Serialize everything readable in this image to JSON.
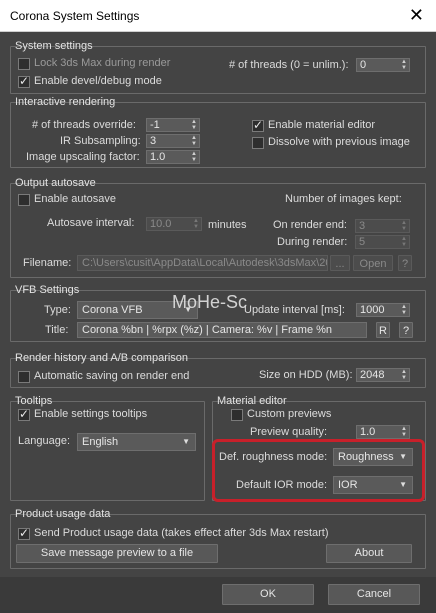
{
  "window": {
    "title": "Corona System Settings",
    "close": "✕"
  },
  "system": {
    "legend": "System settings",
    "lock_label": "Lock 3ds Max during render",
    "lock_checked": false,
    "devel_label": "Enable devel/debug mode",
    "devel_checked": true,
    "threads_label": "# of threads (0 = unlim.):",
    "threads_value": "0"
  },
  "interactive": {
    "legend": "Interactive rendering",
    "threads_override_label": "# of threads override:",
    "threads_override_value": "-1",
    "ir_sub_label": "IR Subsampling:",
    "ir_sub_value": "3",
    "upscale_label": "Image upscaling factor:",
    "upscale_value": "1.0",
    "material_editor_label": "Enable material editor",
    "material_editor_checked": true,
    "dissolve_label": "Dissolve with previous image",
    "dissolve_checked": false
  },
  "autosave": {
    "legend": "Output autosave",
    "enable_label": "Enable autosave",
    "enable_checked": false,
    "keep_label": "Number of images kept:",
    "interval_label": "Autosave interval:",
    "interval_value": "10.0",
    "minutes_label": "minutes",
    "on_end_label": "On render end:",
    "on_end_value": "3",
    "during_label": "During render:",
    "during_value": "5",
    "filename_label": "Filename:",
    "filename_value": "C:\\Users\\cusit\\AppData\\Local\\Autodesk\\3dsMax\\20",
    "ellipsis_button": "...",
    "open_button": "Open",
    "help_button": "?"
  },
  "vfb": {
    "legend": "VFB Settings",
    "type_label": "Type:",
    "type_value": "Corona VFB",
    "update_label": "Update interval [ms]:",
    "update_value": "1000",
    "title_label": "Title:",
    "title_value": "Corona %bn | %rpx (%z) | Camera: %v | Frame %n",
    "r_button": "R",
    "help_button": "?"
  },
  "watermark": "MoHe-Sc",
  "history": {
    "legend": "Render history and A/B comparison",
    "auto_label": "Automatic saving on render end",
    "auto_checked": false,
    "size_label": "Size on HDD (MB):",
    "size_value": "2048"
  },
  "tooltips": {
    "legend": "Tooltips",
    "enable_label": "Enable settings tooltips",
    "enable_checked": true,
    "language_label": "Language:",
    "language_value": "English"
  },
  "material_editor": {
    "legend": "Material editor",
    "custom_label": "Custom previews",
    "custom_checked": false,
    "quality_label": "Preview quality:",
    "quality_value": "1.0",
    "roughness_label": "Def. roughness mode:",
    "roughness_value": "Roughness",
    "ior_label": "Default IOR mode:",
    "ior_value": "IOR"
  },
  "usage": {
    "legend": "Product usage data",
    "send_label": "Send Product usage data (takes effect after 3ds Max restart)",
    "send_checked": true,
    "preview_button": "Save message preview to a file",
    "about_button": "About"
  },
  "buttons": {
    "ok": "OK",
    "cancel": "Cancel"
  },
  "colors": {
    "highlight": "#c8202a",
    "background": "#444444"
  }
}
